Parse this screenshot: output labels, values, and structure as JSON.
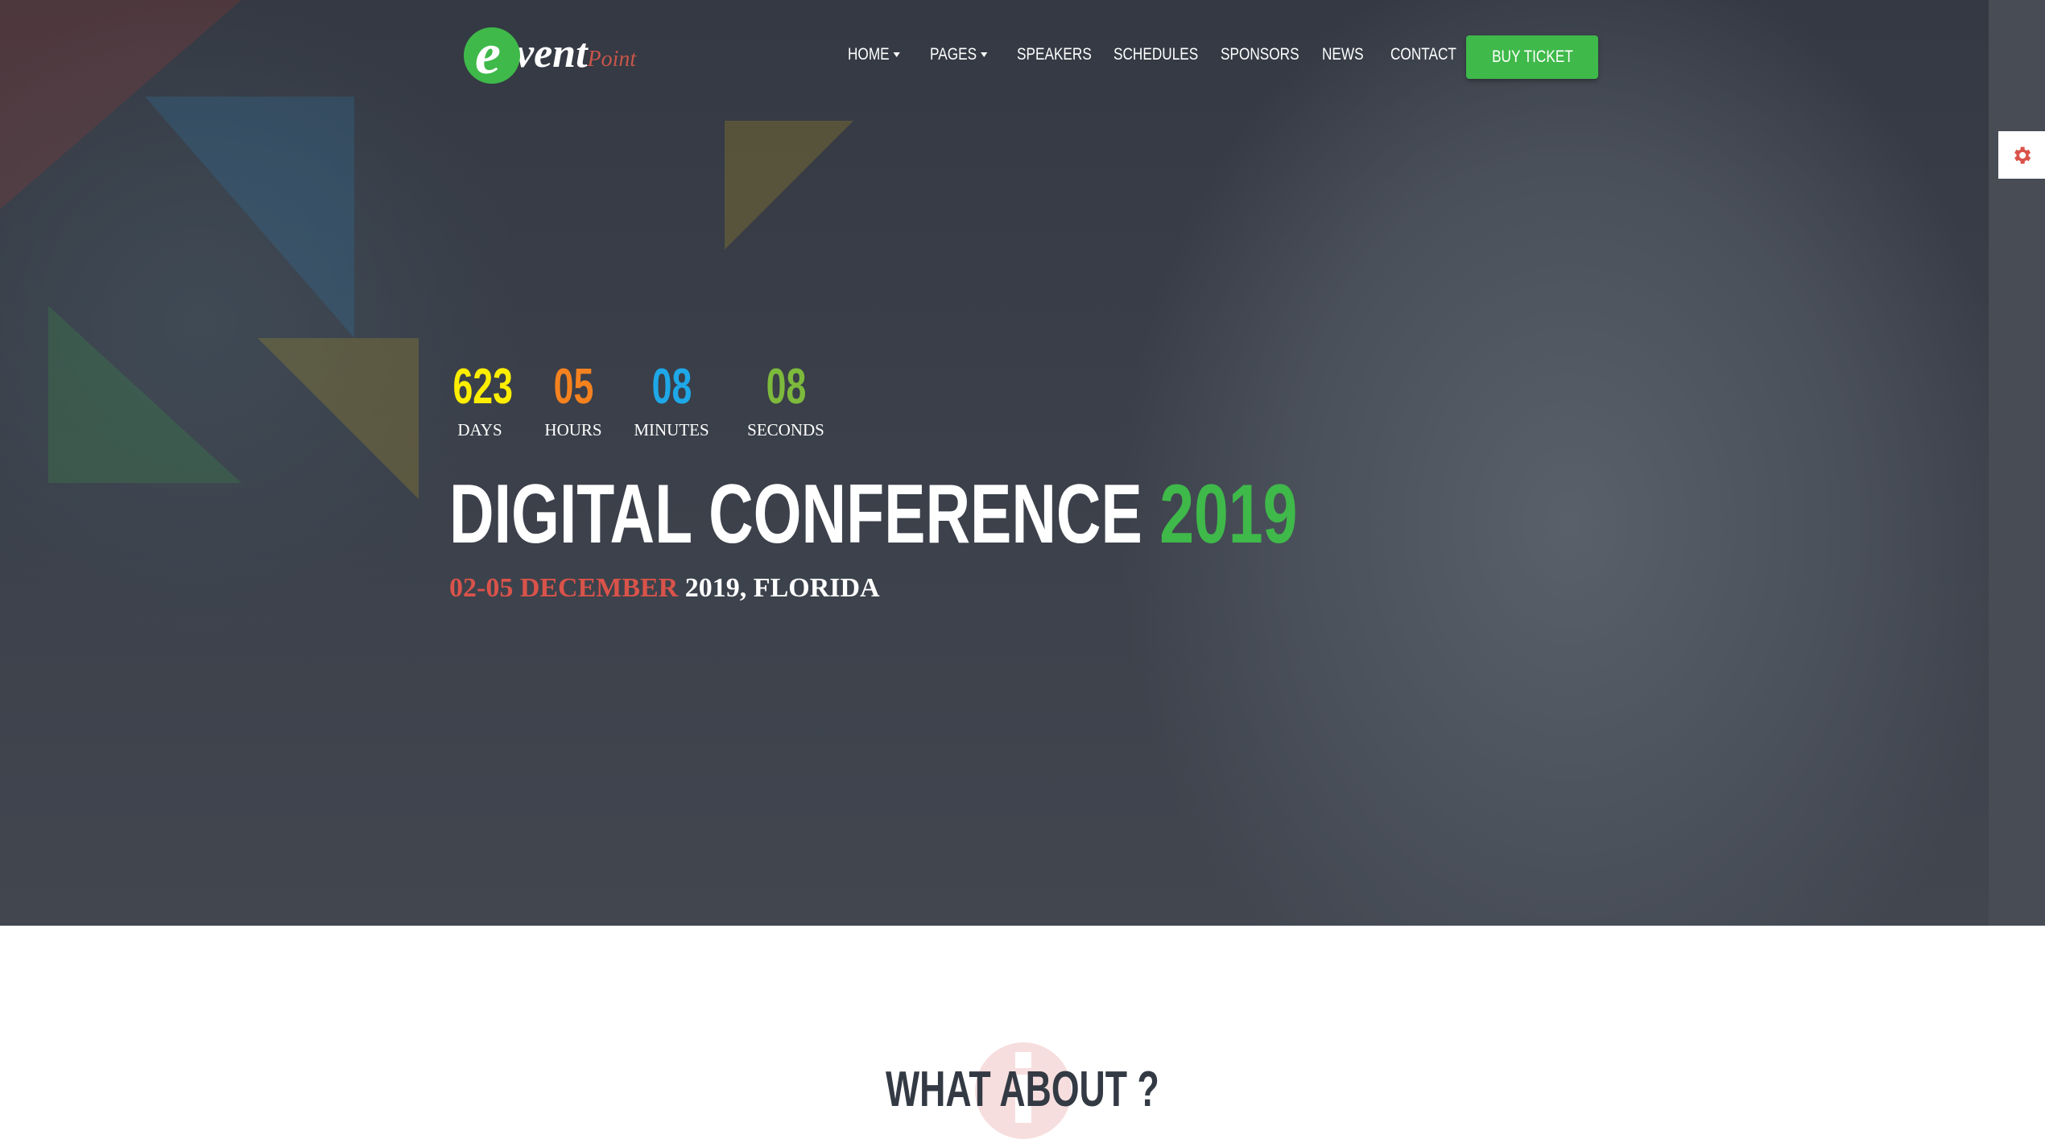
{
  "header": {
    "logo_text": "eventPoint",
    "logo_main": "vent",
    "logo_initial": "e",
    "logo_suffix": "Point",
    "nav": [
      {
        "label": "HOME",
        "dropdown": true
      },
      {
        "label": "PAGES",
        "dropdown": true
      },
      {
        "label": "SPEAKERS"
      },
      {
        "label": "SCHEDULES"
      },
      {
        "label": "SPONSORS"
      },
      {
        "label": "NEWS"
      },
      {
        "label": "CONTACT"
      }
    ],
    "buy_ticket": "BUY TICKET"
  },
  "settings": {
    "icon": "gear-icon"
  },
  "countdown": [
    {
      "value": "623",
      "label": "DAYS",
      "color": "#ffee00"
    },
    {
      "value": "05",
      "label": "HOURS",
      "color": "#f5821f"
    },
    {
      "value": "08",
      "label": "MINUTES",
      "color": "#1ea8e8"
    },
    {
      "value": "08",
      "label": "SECONDS",
      "color": "#7dba3c"
    }
  ],
  "hero": {
    "title": "DIGITAL CONFERENCE",
    "title_year": "2019",
    "date_highlight": "02-05 DECEMBER",
    "date_rest": "2019, FLORIDA"
  },
  "about": {
    "title": "WHAT ABOUT ?"
  },
  "colors": {
    "accent": "#3fb94a",
    "red": "#d9534a",
    "dark": "#333a44"
  }
}
